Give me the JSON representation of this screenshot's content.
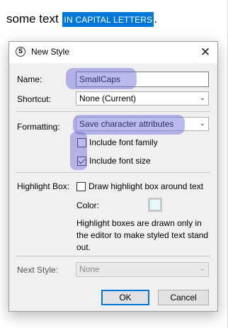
{
  "document": {
    "plain_text": "some text ",
    "selected_text": "IN CAPITAL LETTERS",
    "trailing_text": "."
  },
  "dialog": {
    "title": "New Style",
    "close_glyph": "✕",
    "app_icon_letter": "S",
    "name": {
      "label": "Name:",
      "value": "SmallCaps"
    },
    "shortcut": {
      "label": "Shortcut:",
      "value": "None (Current)"
    },
    "formatting": {
      "label": "Formatting:",
      "value": "Save character attributes",
      "include_font_family": {
        "label": "Include font family",
        "checked": false
      },
      "include_font_size": {
        "label": "Include font size",
        "checked": true
      }
    },
    "highlight_box": {
      "label": "Highlight Box:",
      "checkbox_label": "Draw highlight box around text",
      "checked": false,
      "color_label": "Color:",
      "color_value": "#e2f8fa",
      "note": "Highlight boxes are drawn only in the editor to make styled text stand out."
    },
    "next_style": {
      "label": "Next Style:",
      "value": "None",
      "disabled": true
    },
    "ok_label": "OK",
    "cancel_label": "Cancel"
  },
  "colors": {
    "selection": "#0078d7",
    "annotation_highlight": "#6565dc"
  }
}
